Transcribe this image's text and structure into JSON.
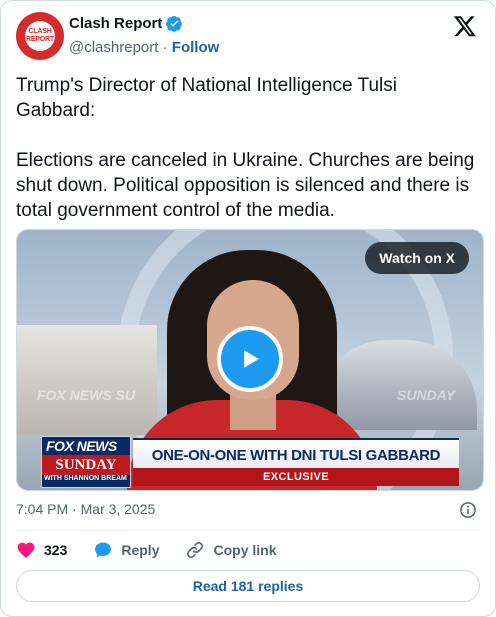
{
  "author": {
    "name": "Clash Report",
    "handle": "@clashreport",
    "separator": "·",
    "follow_label": "Follow",
    "avatar_text_top": "CLASH",
    "avatar_text_bottom": "REPORT",
    "verified": true
  },
  "tweet": {
    "text": "Trump's Director of National Intelligence Tulsi Gabbard:\n\nElections are canceled in Ukraine. Churches are being shut down. Political opposition is silenced and there is total government control of the media."
  },
  "media": {
    "watch_label": "Watch on X",
    "watermark_left": "FOX NEWS SU",
    "watermark_right": "SUNDAY",
    "lower_third": {
      "logo_top": "FOX NEWS",
      "logo_bottom": "SUNDAY",
      "host": "WITH SHANNON BREAM",
      "headline": "ONE-ON-ONE WITH DNI TULSI GABBARD",
      "tag": "EXCLUSIVE"
    }
  },
  "timestamp": "7:04 PM · Mar 3, 2025",
  "actions": {
    "likes": "323",
    "reply_label": "Reply",
    "copy_link_label": "Copy link"
  },
  "read_replies_label": "Read 181 replies",
  "colors": {
    "accent": "#1d9bf0",
    "link": "#1d63a8",
    "like": "#f91880",
    "muted": "#536471",
    "brand_red": "#d52b2b"
  },
  "icons": [
    "x-logo-icon",
    "verified-badge-icon",
    "play-icon",
    "info-icon",
    "heart-icon",
    "reply-icon",
    "link-icon"
  ]
}
